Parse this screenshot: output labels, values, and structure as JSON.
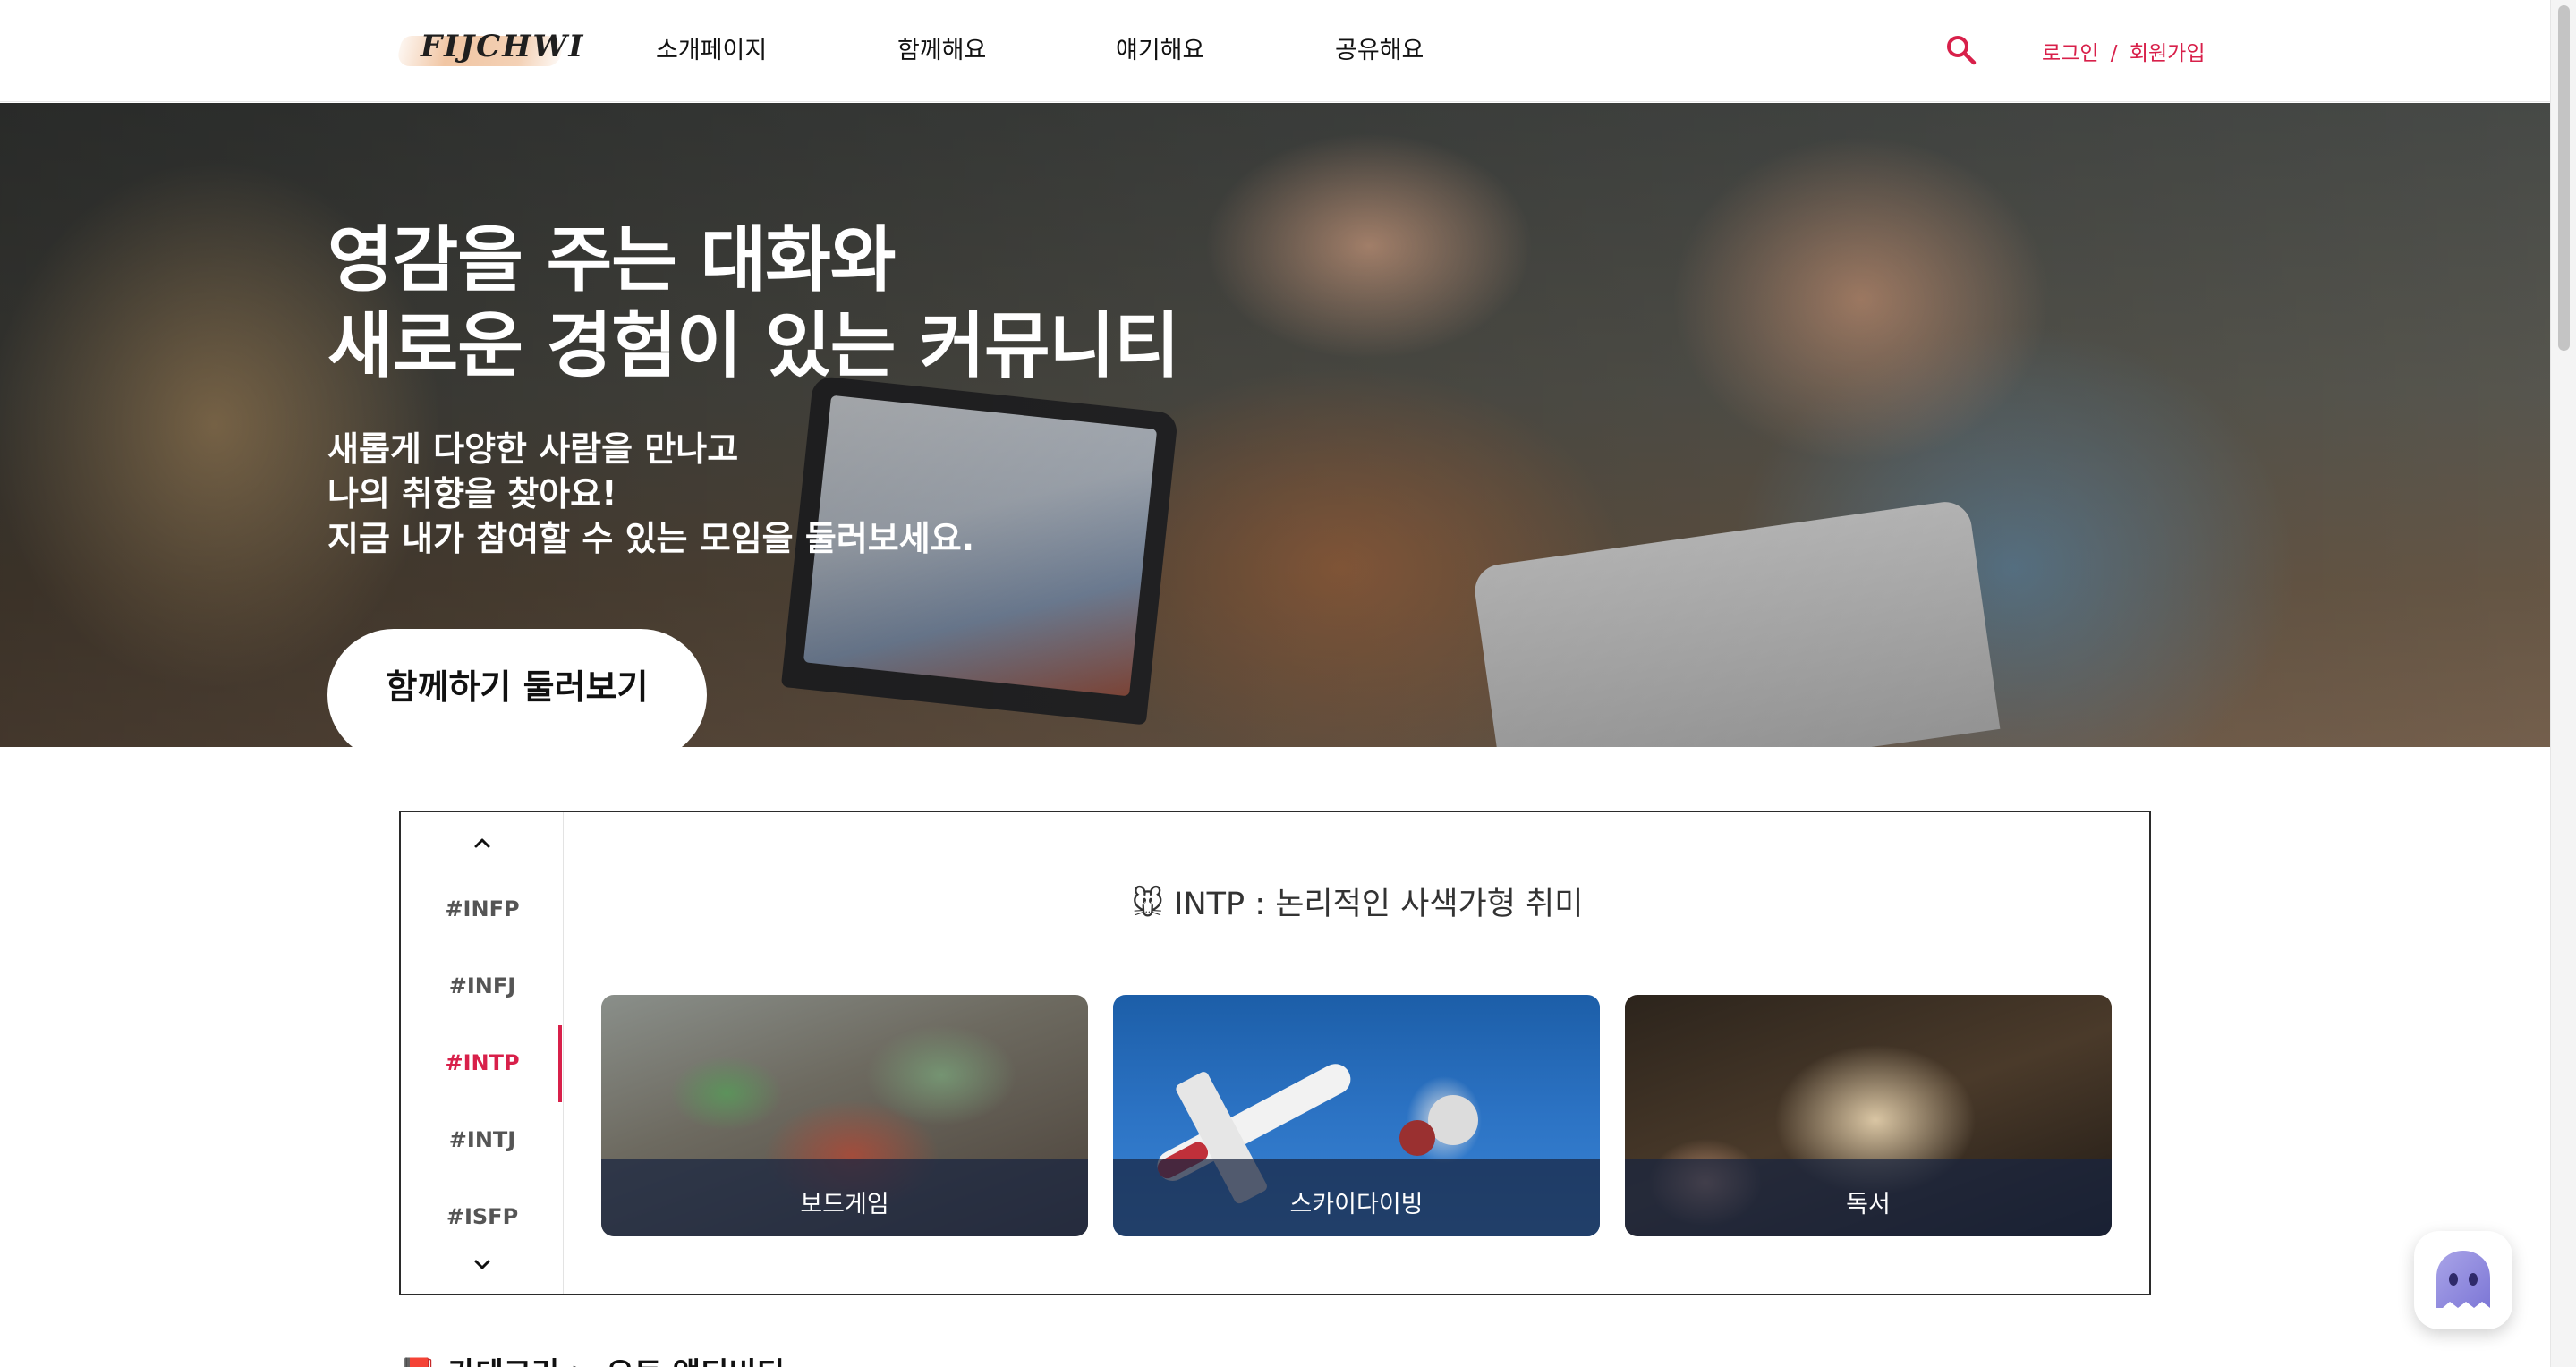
{
  "header": {
    "logo_text": "FIJCHWI",
    "nav": [
      {
        "label": "소개페이지"
      },
      {
        "label": "함께해요"
      },
      {
        "label": "얘기해요"
      },
      {
        "label": "공유해요"
      }
    ],
    "login_label": "로그인",
    "separator": "/",
    "signup_label": "회원가입",
    "accent_color": "#d8204a"
  },
  "hero": {
    "title_line1": "영감을 주는 대화와",
    "title_line2": "새로운 경험이 있는 커뮤니티",
    "sub_line1": "새롭게 다양한 사람을 만나고",
    "sub_line2": "나의 취향을 찾아요!",
    "sub_line3": "지금 내가 참여할 수 있는 모임을 둘러보세요.",
    "cta_label": "함께하기 둘러보기"
  },
  "mbti_panel": {
    "types": [
      "#INFP",
      "#INFJ",
      "#INTP",
      "#INTJ",
      "#ISFP"
    ],
    "active_type": "#INTP",
    "title_icon": "🐭",
    "title": "INTP : 논리적인 사색가형 취미",
    "cards": [
      {
        "label": "보드게임",
        "image": "board-game-photo"
      },
      {
        "label": "스카이다이빙",
        "image": "skydiving-photo"
      },
      {
        "label": "독서",
        "image": "reading-photo"
      }
    ]
  },
  "next_section": {
    "icon": "📕",
    "heading": "카테고리 > 요트 액티비티"
  },
  "chatbot": {
    "icon": "ghost-chatbot-icon"
  }
}
